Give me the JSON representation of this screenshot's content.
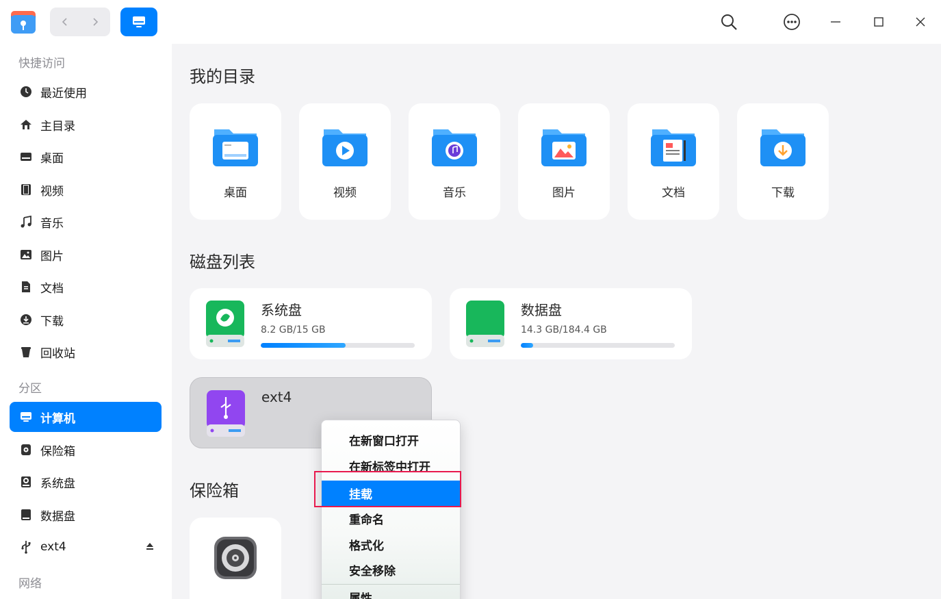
{
  "titlebar": {
    "icons": [
      "file-manager-logo",
      "back-arrow-icon",
      "forward-arrow-icon",
      "computer-icon",
      "search-icon",
      "more-menu-icon",
      "minimize-icon",
      "maximize-icon",
      "close-icon"
    ]
  },
  "sidebar": {
    "sections": {
      "quick": "快捷访问",
      "partitions": "分区",
      "network": "网络"
    },
    "quick_items": [
      {
        "label": "最近使用",
        "icon": "clock-icon"
      },
      {
        "label": "主目录",
        "icon": "home-icon"
      },
      {
        "label": "桌面",
        "icon": "desktop-icon"
      },
      {
        "label": "视频",
        "icon": "film-icon"
      },
      {
        "label": "音乐",
        "icon": "music-note-icon"
      },
      {
        "label": "图片",
        "icon": "image-icon"
      },
      {
        "label": "文档",
        "icon": "document-icon"
      },
      {
        "label": "下载",
        "icon": "download-icon"
      },
      {
        "label": "回收站",
        "icon": "trash-icon"
      }
    ],
    "partition_items": [
      {
        "label": "计算机",
        "icon": "computer-icon",
        "active": true
      },
      {
        "label": "保险箱",
        "icon": "vault-icon"
      },
      {
        "label": "系统盘",
        "icon": "system-disk-icon"
      },
      {
        "label": "数据盘",
        "icon": "data-disk-icon"
      },
      {
        "label": "ext4",
        "icon": "usb-icon",
        "eject": "eject-icon"
      }
    ]
  },
  "main": {
    "my_dirs_title": "我的目录",
    "folders": [
      {
        "label": "桌面",
        "icon": "desktop-folder-icon"
      },
      {
        "label": "视频",
        "icon": "video-folder-icon"
      },
      {
        "label": "音乐",
        "icon": "music-folder-icon"
      },
      {
        "label": "图片",
        "icon": "pictures-folder-icon"
      },
      {
        "label": "文档",
        "icon": "documents-folder-icon"
      },
      {
        "label": "下载",
        "icon": "downloads-folder-icon"
      }
    ],
    "disk_list_title": "磁盘列表",
    "disks": [
      {
        "name": "系统盘",
        "size": "8.2 GB/15 GB",
        "usage": 0.55,
        "icon": "system-drive-icon"
      },
      {
        "name": "数据盘",
        "size": "14.3 GB/184.4 GB",
        "usage": 0.08,
        "icon": "data-drive-icon"
      },
      {
        "name": "ext4",
        "icon": "usb-drive-icon"
      }
    ],
    "vault_title": "保险箱",
    "vault_icon": "safe-icon"
  },
  "context_menu": {
    "items": [
      "在新窗口打开",
      "在新标签中打开",
      "挂载",
      "重命名",
      "格式化",
      "安全移除",
      "属性"
    ],
    "highlighted": "挂载"
  },
  "colors": {
    "accent": "#0081ff",
    "highlight_box": "#e8194d"
  }
}
